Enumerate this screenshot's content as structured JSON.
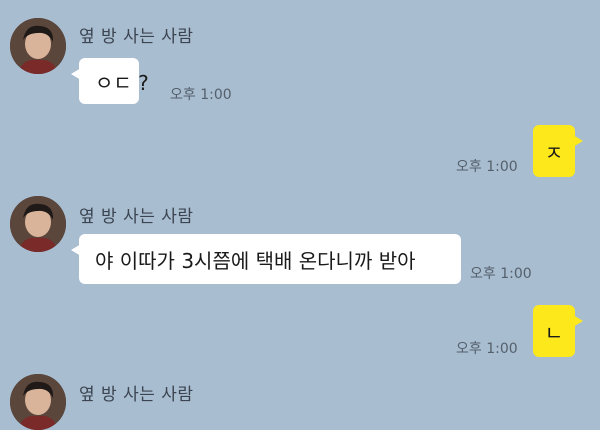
{
  "chat": {
    "sender_name": "옆 방 사는 사람",
    "messages": [
      {
        "from": "other",
        "text": "ㅇㄷ ?",
        "time": "오후 1:00"
      },
      {
        "from": "me",
        "text": "ㅈ",
        "time": "오후 1:00"
      },
      {
        "from": "other",
        "text": "야 이따가 3시쯤에 택배 온다니까 받아",
        "time": "오후 1:00"
      },
      {
        "from": "me",
        "text": "ㄴ",
        "time": "오후 1:00"
      },
      {
        "from": "other",
        "text": "",
        "time": ""
      }
    ]
  },
  "colors": {
    "background": "#a8bdd0",
    "incoming_bubble": "#ffffff",
    "outgoing_bubble": "#fde81b"
  }
}
